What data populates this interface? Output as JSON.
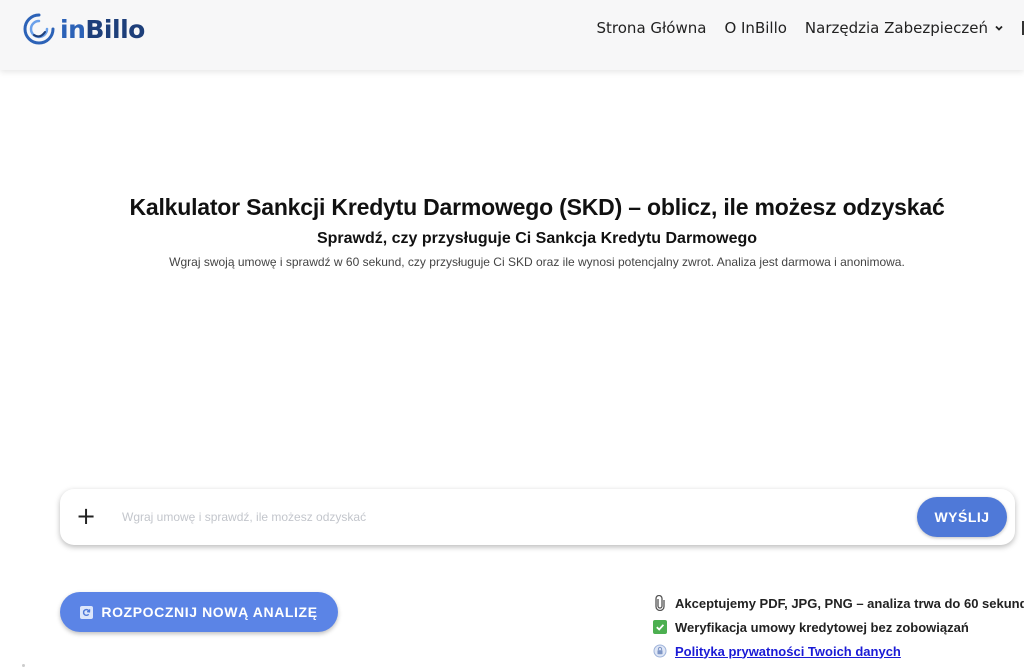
{
  "header": {
    "logo": {
      "in": "in",
      "billo": "Billo"
    },
    "nav": [
      {
        "label": "Strona Główna"
      },
      {
        "label": "O InBillo"
      },
      {
        "label": "Narzędzia Zabezpieczeń",
        "has_dropdown": true
      }
    ]
  },
  "hero": {
    "title": "Kalkulator Sankcji Kredytu Darmowego (SKD) – oblicz, ile możesz odzyskać",
    "subtitle": "Sprawdź, czy przysługuje Ci Sankcja Kredytu Darmowego",
    "description": "Wgraj swoją umowę i sprawdź w 60 sekund, czy przysługuje Ci SKD oraz ile wynosi potencjalny zwrot. Analiza jest darmowa i anonimowa."
  },
  "chat": {
    "attach_icon": "plus-icon",
    "input_value": "",
    "placeholder": "Wgraj umowę i sprawdź, ile możesz odzyskać",
    "send_label": "WYŚLIJ"
  },
  "actions": {
    "new_analysis_label": "ROZPOCZNIJ NOWĄ ANALIZĘ",
    "new_analysis_icon": "refresh-icon"
  },
  "info": [
    {
      "icon": "paperclip-icon",
      "text": "Akceptujemy PDF, JPG, PNG – analiza trwa do 60 sekund"
    },
    {
      "icon": "checkmark-icon",
      "text": "Weryfikacja umowy kredytowej bez zobowiązań"
    },
    {
      "icon": "lock-icon",
      "text": "Polityka prywatności Twoich danych",
      "is_link": true
    }
  ],
  "colors": {
    "brand_blue": "#2c62b7",
    "brand_navy": "#1e3f7a",
    "button_blue": "#4f79d8",
    "check_green": "#4caf50",
    "link_blue": "#1a1ad6"
  }
}
